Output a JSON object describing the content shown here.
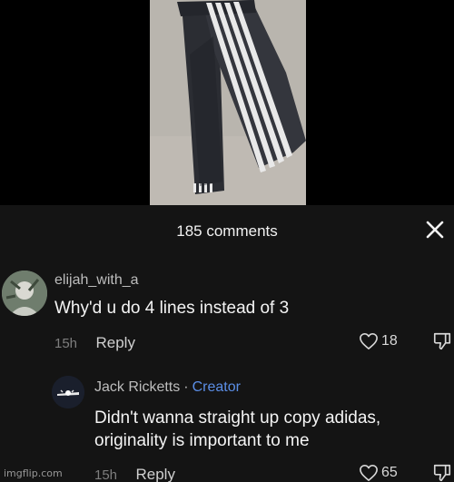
{
  "media": {
    "icon": "jeans-photo"
  },
  "comments_sheet": {
    "title": "185 comments",
    "close_icon": "close-icon"
  },
  "comments": [
    {
      "username": "elijah_with_a",
      "text": "Why'd u do 4 lines instead of 3",
      "time": "15h",
      "reply_label": "Reply",
      "likes": "18"
    },
    {
      "username": "Jack Ricketts",
      "separator": "·",
      "badge": "Creator",
      "text_line1": "Didn't wanna straight up copy adidas,",
      "text_line2": "originality is important to me",
      "time": "15h",
      "reply_label": "Reply",
      "likes": "65"
    }
  ],
  "watermark": "imgflip.com",
  "colors": {
    "sheet_bg": "#141414",
    "creator": "#5b8ee6"
  }
}
